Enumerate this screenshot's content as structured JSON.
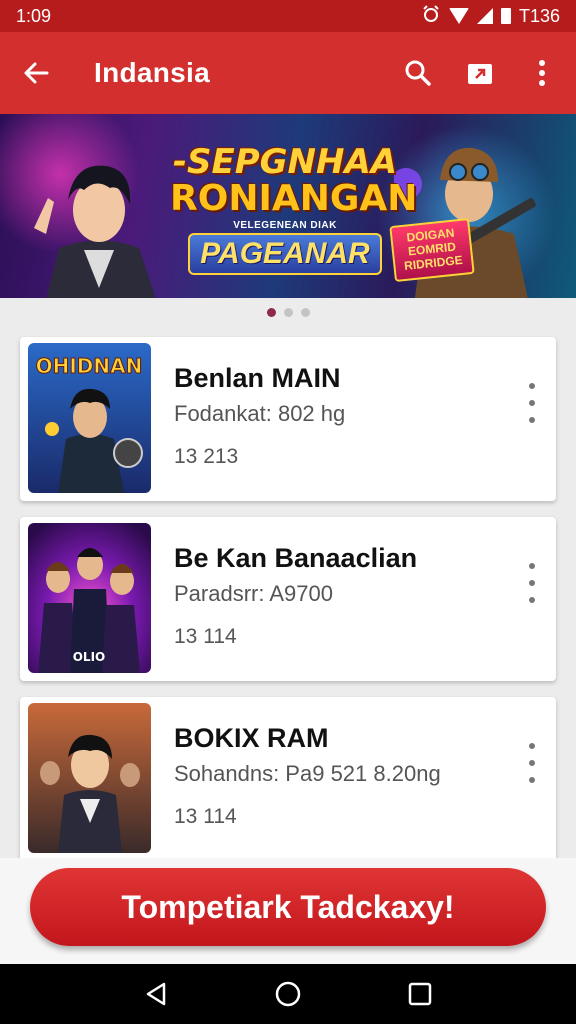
{
  "status_bar": {
    "time": "1:09",
    "right_text": "T136"
  },
  "app_bar": {
    "title": "Indansia",
    "icons": [
      "back-arrow-icon",
      "search-icon",
      "share-icon",
      "more-vert-icon"
    ]
  },
  "banner": {
    "line1": "-SEPGNHAA",
    "line2": "RONIANGAN",
    "subtitle": "VELEGENEAN DIAK",
    "line3": "PAGEANAR",
    "badge": "DOIGAN EOMRID RIDRIDGE"
  },
  "carousel": {
    "pages": 3,
    "active": 1
  },
  "games": [
    {
      "title": "Benlan MAIN",
      "subtitle": "Fodankat: 802 hg",
      "meta": "13 213",
      "thumb_text": "OHIDNAN"
    },
    {
      "title": "Be Kan Banaaclian",
      "subtitle": "Paradsrr: A9700",
      "meta": "13 114",
      "thumb_text": "OLIO"
    },
    {
      "title": "BOKIX RAM",
      "subtitle": "Sohandns: Pa9 521 8.20ng",
      "meta": "13 114",
      "thumb_text": ""
    }
  ],
  "cta": {
    "label": "Tompetiark Tadckaxy!"
  },
  "colors": {
    "primary": "#d32f2f",
    "status": "#b71c1c",
    "dot_active": "#8e2a48"
  }
}
